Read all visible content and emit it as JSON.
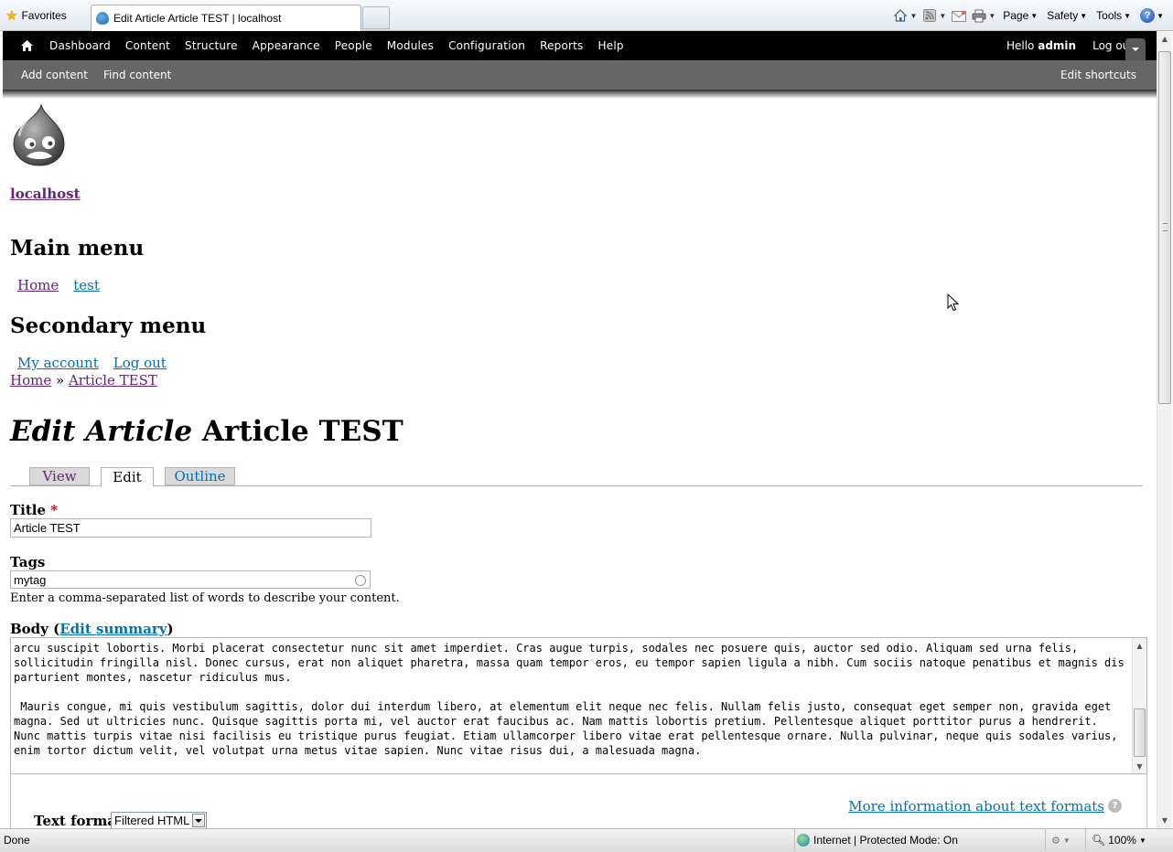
{
  "browser": {
    "favorites_label": "Favorites",
    "tab_title": "Edit Article Article TEST | localhost",
    "menus": [
      "Page",
      "Safety",
      "Tools"
    ],
    "icons": [
      "home-icon",
      "feeds-icon",
      "read-mail-icon",
      "print-icon",
      "help-icon"
    ]
  },
  "toolbar": {
    "items": [
      "Dashboard",
      "Content",
      "Structure",
      "Appearance",
      "People",
      "Modules",
      "Configuration",
      "Reports",
      "Help"
    ],
    "hello_prefix": "Hello",
    "username": "admin",
    "logout": "Log out",
    "shortcuts": [
      "Add content",
      "Find content"
    ],
    "edit_shortcuts": "Edit shortcuts"
  },
  "site": {
    "name": "localhost"
  },
  "main_menu": {
    "title": "Main menu",
    "items": [
      "Home",
      "test"
    ]
  },
  "secondary_menu": {
    "title": "Secondary menu",
    "items": [
      "My account",
      "Log out"
    ]
  },
  "breadcrumb": {
    "items": [
      "Home",
      "Article TEST"
    ],
    "separator": "»"
  },
  "page": {
    "title_em": "Edit Article",
    "title_rest": "Article TEST"
  },
  "tabs": [
    "View",
    "Edit",
    "Outline"
  ],
  "form": {
    "title_label": "Title",
    "required_mark": "*",
    "title_value": "Article TEST",
    "tags_label": "Tags",
    "tags_value": "mytag",
    "tags_description": "Enter a comma-separated list of words to describe your content.",
    "body_label": "Body",
    "body_label_open": "(",
    "edit_summary": "Edit summary",
    "body_label_close": ")",
    "body_text": "arcu suscipit lobortis. Morbi placerat consectetur nunc sit amet imperdiet. Cras augue turpis, sodales nec posuere quis, auctor sed odio. Aliquam sed urna felis, sollicitudin fringilla nisl. Donec cursus, erat non aliquet pharetra, massa quam tempor eros, eu tempor sapien ligula a nibh. Cum sociis natoque penatibus et magnis dis parturient montes, nascetur ridiculus mus.\n\n Mauris congue, mi quis vestibulum sagittis, dolor dui interdum libero, at elementum elit neque nec felis. Nullam felis justo, consequat eget semper non, gravida eget magna. Sed ut ultricies nunc. Quisque sagittis porta mi, vel auctor erat faucibus ac. Nam mattis lobortis pretium. Pellentesque aliquet porttitor purus a hendrerit. Nunc mattis turpis vitae nisi facilisis eu tristique purus feugiat. Etiam ullamcorper libero vitae erat pellentesque ornare. Nulla pulvinar, neque quis sodales varius, enim tortor dictum velit, vel volutpat urna metus vitae sapien. Nunc vitae risus dui, a malesuada magna.",
    "more_info": "More information about text formats",
    "text_format_label": "Text format",
    "text_format_value": "Filtered HTML"
  },
  "status": {
    "done": "Done",
    "zone": "Internet | Protected Mode: On",
    "zoom": "100%"
  },
  "colors": {
    "link": "#0071b3",
    "visited": "#68217a",
    "toolbar_bg": "#000000",
    "shortcuts_bg": "#666666",
    "required": "#cc0000"
  }
}
